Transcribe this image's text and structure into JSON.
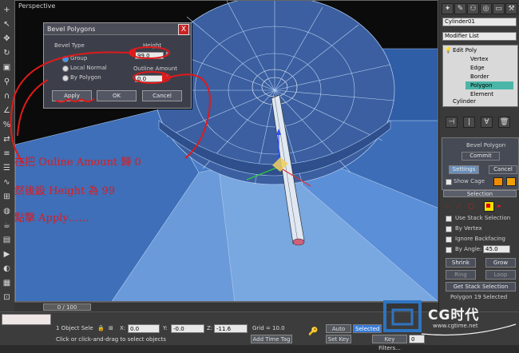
{
  "viewport": {
    "label": "Perspective"
  },
  "dialog": {
    "title": "Bevel Polygons",
    "close_glyph": "X",
    "bevel_type_label": "Bevel Type",
    "bevel_type_options": [
      "Group",
      "Local Normal",
      "By Polygon"
    ],
    "selected_option": "Group",
    "height_label": "Height",
    "height_value": "99.0",
    "outline_label": "Outline Amount",
    "outline_value": "0.0",
    "apply_label": "Apply",
    "ok_label": "OK",
    "cancel_label": "Cancel"
  },
  "annotations": {
    "line1": "在把 Ouline Amount 歸 0",
    "line2": "然後設 Height 為 99",
    "line3": "點擊 Apply……"
  },
  "command_panel": {
    "object_name": "Cylinder01",
    "modifier_list_label": "Modifier List",
    "stack": [
      "Edit Poly",
      "Vertex",
      "Edge",
      "Border",
      "Polygon",
      "Element",
      "Cylinder"
    ],
    "selected_stack_item": "Polygon",
    "bevel_section_title": "Bevel Polygon",
    "commit_label": "Commit",
    "settings_label": "Settings",
    "cancel_label": "Cancel",
    "show_cage_label": "Show Cage",
    "selection_title": "Selection",
    "use_stack_selection_label": "Use Stack Selection",
    "by_vertex_label": "By Vertex",
    "ignore_backfacing_label": "Ignore Backfacing",
    "by_angle_label": "By Angle:",
    "by_angle_value": "45.0",
    "shrink_label": "Shrink",
    "grow_label": "Grow",
    "ring_label": "Ring",
    "loop_label": "Loop",
    "get_stack_selection_label": "Get Stack Selection",
    "selection_status": "Polygon 19 Selected",
    "cage_colors": [
      "#f08a00",
      "#f0a000"
    ]
  },
  "timeline": {
    "frame_label": "0 / 100"
  },
  "status_bar": {
    "selection_info": "1 Object Sele",
    "x_label": "X:",
    "x_value": "0.0",
    "y_label": "Y:",
    "y_value": "-0.0",
    "z_label": "Z:",
    "z_value": "-11.6",
    "grid_label": "Grid = 10.0",
    "auto_key_label": "Auto Key",
    "selected_label": "Selected",
    "set_key_label": "Set Key",
    "key_filters_label": "Key Filters...",
    "frame_value": "0",
    "prompt": "Click or click-and-drag to select objects",
    "add_time_tag_label": "Add Time Tag"
  },
  "watermark": {
    "brand": "CG时代",
    "site": "www.cgtime.net"
  },
  "colors": {
    "annotation": "#e01a1a",
    "accent": "#39f",
    "mesh_light": "#5b8fd8",
    "mesh_dark": "#2f4f86"
  }
}
